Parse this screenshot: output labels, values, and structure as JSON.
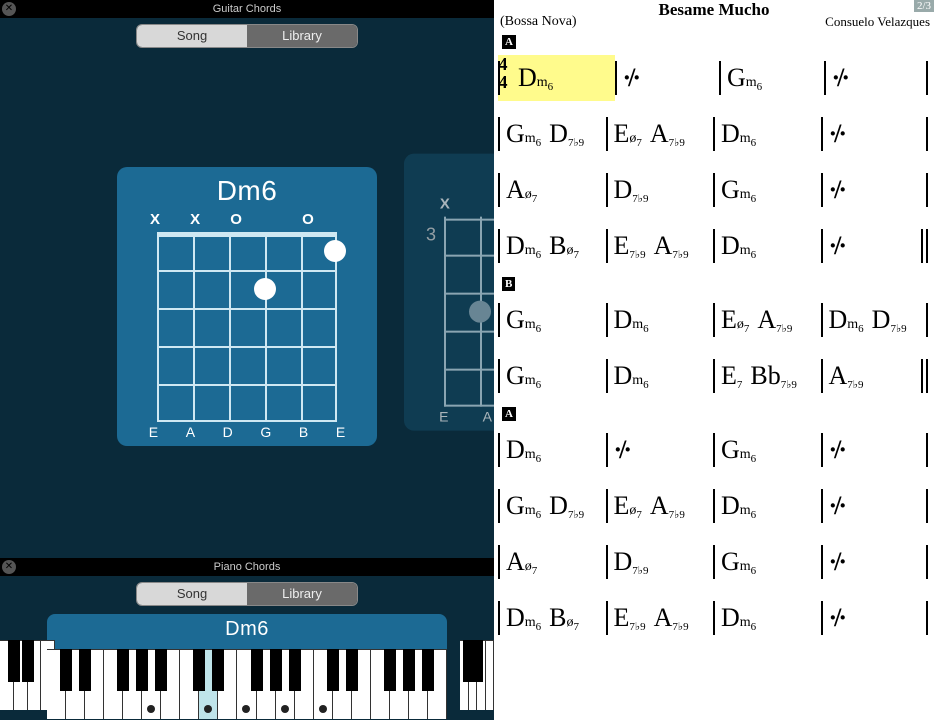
{
  "guitar": {
    "title": "Guitar Chords",
    "tabs": {
      "song": "Song",
      "library": "Library"
    },
    "chord_name": "Dm6",
    "top_markers": [
      "X",
      "X",
      "O",
      "",
      "O",
      ""
    ],
    "string_names": [
      "E",
      "A",
      "D",
      "G",
      "B",
      "E"
    ],
    "alt_fret_label": "3",
    "alt_top_markers": [
      "X",
      "",
      "",
      "",
      "",
      ""
    ],
    "alt_string_names": [
      "E",
      "A"
    ]
  },
  "piano": {
    "title": "Piano Chords",
    "tabs": {
      "song": "Song",
      "library": "Library"
    },
    "chord_name": "Dm6"
  },
  "sheet": {
    "title": "Besame Mucho",
    "style": "(Bossa Nova)",
    "composer": "Consuelo Velazques",
    "page": "2/3",
    "time_top": "4",
    "time_bot": "4",
    "sections": [
      {
        "label": "A",
        "rows": [
          {
            "timesig": true,
            "hl": 0,
            "bars": [
              [
                "Dm6"
              ],
              [
                "%"
              ],
              [
                "Gm6"
              ],
              [
                "%"
              ]
            ]
          },
          {
            "bars": [
              [
                "Gm6",
                "D7b9"
              ],
              [
                "Eo7",
                "A7b9"
              ],
              [
                "Dm6"
              ],
              [
                "%"
              ]
            ]
          },
          {
            "bars": [
              [
                "Ao7"
              ],
              [
                "D7b9"
              ],
              [
                "Gm6"
              ],
              [
                "%"
              ]
            ]
          },
          {
            "dbl": true,
            "bars": [
              [
                "Dm6",
                "Bo7"
              ],
              [
                "E7b9",
                "A7b9"
              ],
              [
                "Dm6"
              ],
              [
                "%"
              ]
            ]
          }
        ]
      },
      {
        "label": "B",
        "rows": [
          {
            "bars": [
              [
                "Gm6"
              ],
              [
                "Dm6"
              ],
              [
                "Eo7",
                "A7b9"
              ],
              [
                "Dm6",
                "D7b9"
              ]
            ]
          },
          {
            "dbl": true,
            "bars": [
              [
                "Gm6"
              ],
              [
                "Dm6"
              ],
              [
                "E7",
                "Bb7b9"
              ],
              [
                "A7b9"
              ]
            ]
          }
        ]
      },
      {
        "label": "A",
        "rows": [
          {
            "bars": [
              [
                "Dm6"
              ],
              [
                "%"
              ],
              [
                "Gm6"
              ],
              [
                "%"
              ]
            ]
          },
          {
            "bars": [
              [
                "Gm6",
                "D7b9"
              ],
              [
                "Eo7",
                "A7b9"
              ],
              [
                "Dm6"
              ],
              [
                "%"
              ]
            ]
          },
          {
            "bars": [
              [
                "Ao7"
              ],
              [
                "D7b9"
              ],
              [
                "Gm6"
              ],
              [
                "%"
              ]
            ]
          },
          {
            "bars": [
              [
                "Dm6",
                "Bo7"
              ],
              [
                "E7b9",
                "A7b9"
              ],
              [
                "Dm6"
              ],
              [
                "%"
              ]
            ]
          }
        ]
      }
    ]
  }
}
